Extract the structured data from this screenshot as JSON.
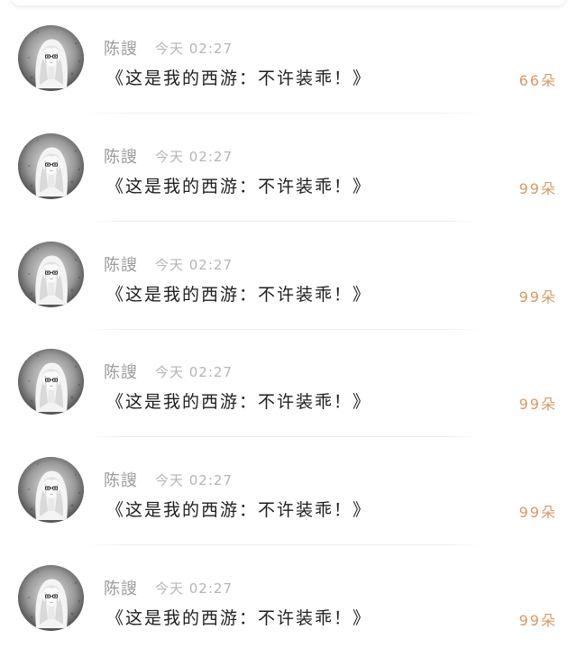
{
  "comments": [
    {
      "username": "陈謏",
      "timestamp": "今天 02:27",
      "title": "《这是我的西游：不许装乖！》",
      "count": "66朵"
    },
    {
      "username": "陈謏",
      "timestamp": "今天 02:27",
      "title": "《这是我的西游：不许装乖！》",
      "count": "99朵"
    },
    {
      "username": "陈謏",
      "timestamp": "今天 02:27",
      "title": "《这是我的西游：不许装乖！》",
      "count": "99朵"
    },
    {
      "username": "陈謏",
      "timestamp": "今天 02:27",
      "title": "《这是我的西游：不许装乖！》",
      "count": "99朵"
    },
    {
      "username": "陈謏",
      "timestamp": "今天 02:27",
      "title": "《这是我的西游：不许装乖！》",
      "count": "99朵"
    },
    {
      "username": "陈謏",
      "timestamp": "今天 02:27",
      "title": "《这是我的西游：不许装乖！》",
      "count": "99朵"
    }
  ],
  "colors": {
    "count": "#d79a62",
    "username": "#9a9a9a",
    "timestamp": "#b5b5b5",
    "title": "#1e1e1e"
  },
  "icons": {
    "avatar": "anime-avatar-grayscale"
  }
}
